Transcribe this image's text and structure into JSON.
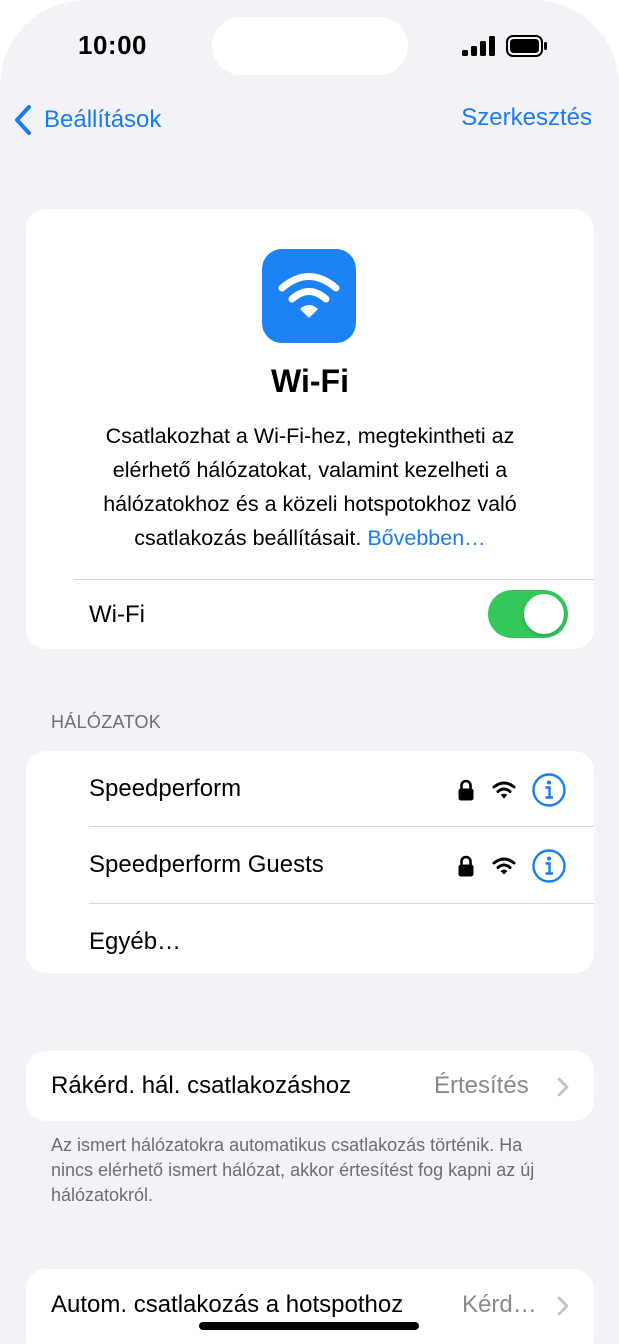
{
  "status_bar": {
    "time": "10:00",
    "icons": [
      "signal-icon",
      "battery-icon"
    ]
  },
  "nav": {
    "back_label": "Beállítások",
    "edit_label": "Szerkesztés"
  },
  "hero": {
    "icon": "wifi-icon",
    "title": "Wi-Fi",
    "description": "Csatlakozhat a Wi-Fi-hez, megtekintheti az elérhető hálózatokat, valamint kezelheti a hálózatokhoz és a közeli hotspotokhoz való csatlakozás beállításait.",
    "learn_more": "Bővebben…",
    "toggle_label": "Wi-Fi",
    "toggle_on": true
  },
  "networks": {
    "header": "HÁLÓZATOK",
    "items": [
      {
        "name": "Speedperform",
        "locked": true
      },
      {
        "name": "Speedperform Guests",
        "locked": true
      }
    ],
    "other_label": "Egyéb…"
  },
  "ask_to_join": {
    "label": "Rákérd. hál. csatlakozáshoz",
    "value": "Értesítés",
    "note": "Az ismert hálózatokra automatikus csatlakozás történik. Ha nincs elérhető ismert hálózat, akkor értesítést fog kapni az új hálózatokról."
  },
  "hotspot": {
    "label": "Autom. csatlakozás a hotspothoz",
    "value": "Kérd…"
  },
  "colors": {
    "accent": "#1a7cf0",
    "toggle_on": "#34c759",
    "background": "#f2f2f7"
  }
}
